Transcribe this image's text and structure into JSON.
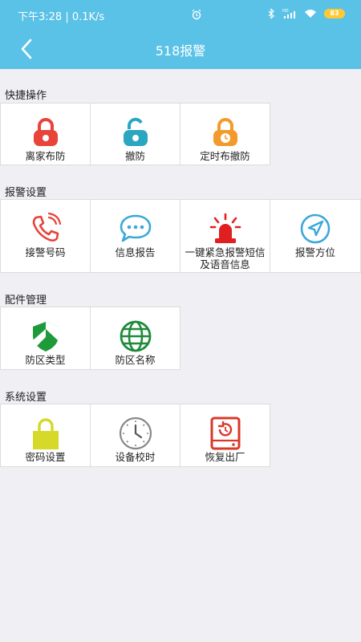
{
  "status_bar": {
    "time_text": "下午3:28 | 0.1K/s",
    "battery": "83"
  },
  "header": {
    "title": "518报警"
  },
  "sections": [
    {
      "title": "快捷操作",
      "items": [
        {
          "label": "离家布防",
          "icon": "lock-closed-icon",
          "color": "#e8443a"
        },
        {
          "label": "撤防",
          "icon": "lock-open-icon",
          "color": "#2aa6c0"
        },
        {
          "label": "定时布撤防",
          "icon": "lock-timer-icon",
          "color": "#f39a2c"
        }
      ]
    },
    {
      "title": "报警设置",
      "items": [
        {
          "label": "接警号码",
          "icon": "phone-icon",
          "color": "#e8443a"
        },
        {
          "label": "信息报告",
          "icon": "chat-bubble-icon",
          "color": "#3aa8d8"
        },
        {
          "label": "一键紧急报警短信及语音信息",
          "icon": "alarm-siren-icon",
          "color": "#e02020"
        },
        {
          "label": "报警方位",
          "icon": "location-arrow-icon",
          "color": "#3aa8d8"
        }
      ]
    },
    {
      "title": "配件管理",
      "items": [
        {
          "label": "防区类型",
          "icon": "shield-icon",
          "color": "#1f9a3a"
        },
        {
          "label": "防区名称",
          "icon": "globe-icon",
          "color": "#1f8a3a"
        }
      ]
    },
    {
      "title": "系统设置",
      "items": [
        {
          "label": "密码设置",
          "icon": "padlock-icon",
          "color": "#d7d92a"
        },
        {
          "label": "设备校时",
          "icon": "clock-icon",
          "color": "#888888"
        },
        {
          "label": "恢复出厂",
          "icon": "factory-reset-icon",
          "color": "#d8392a"
        }
      ]
    }
  ]
}
